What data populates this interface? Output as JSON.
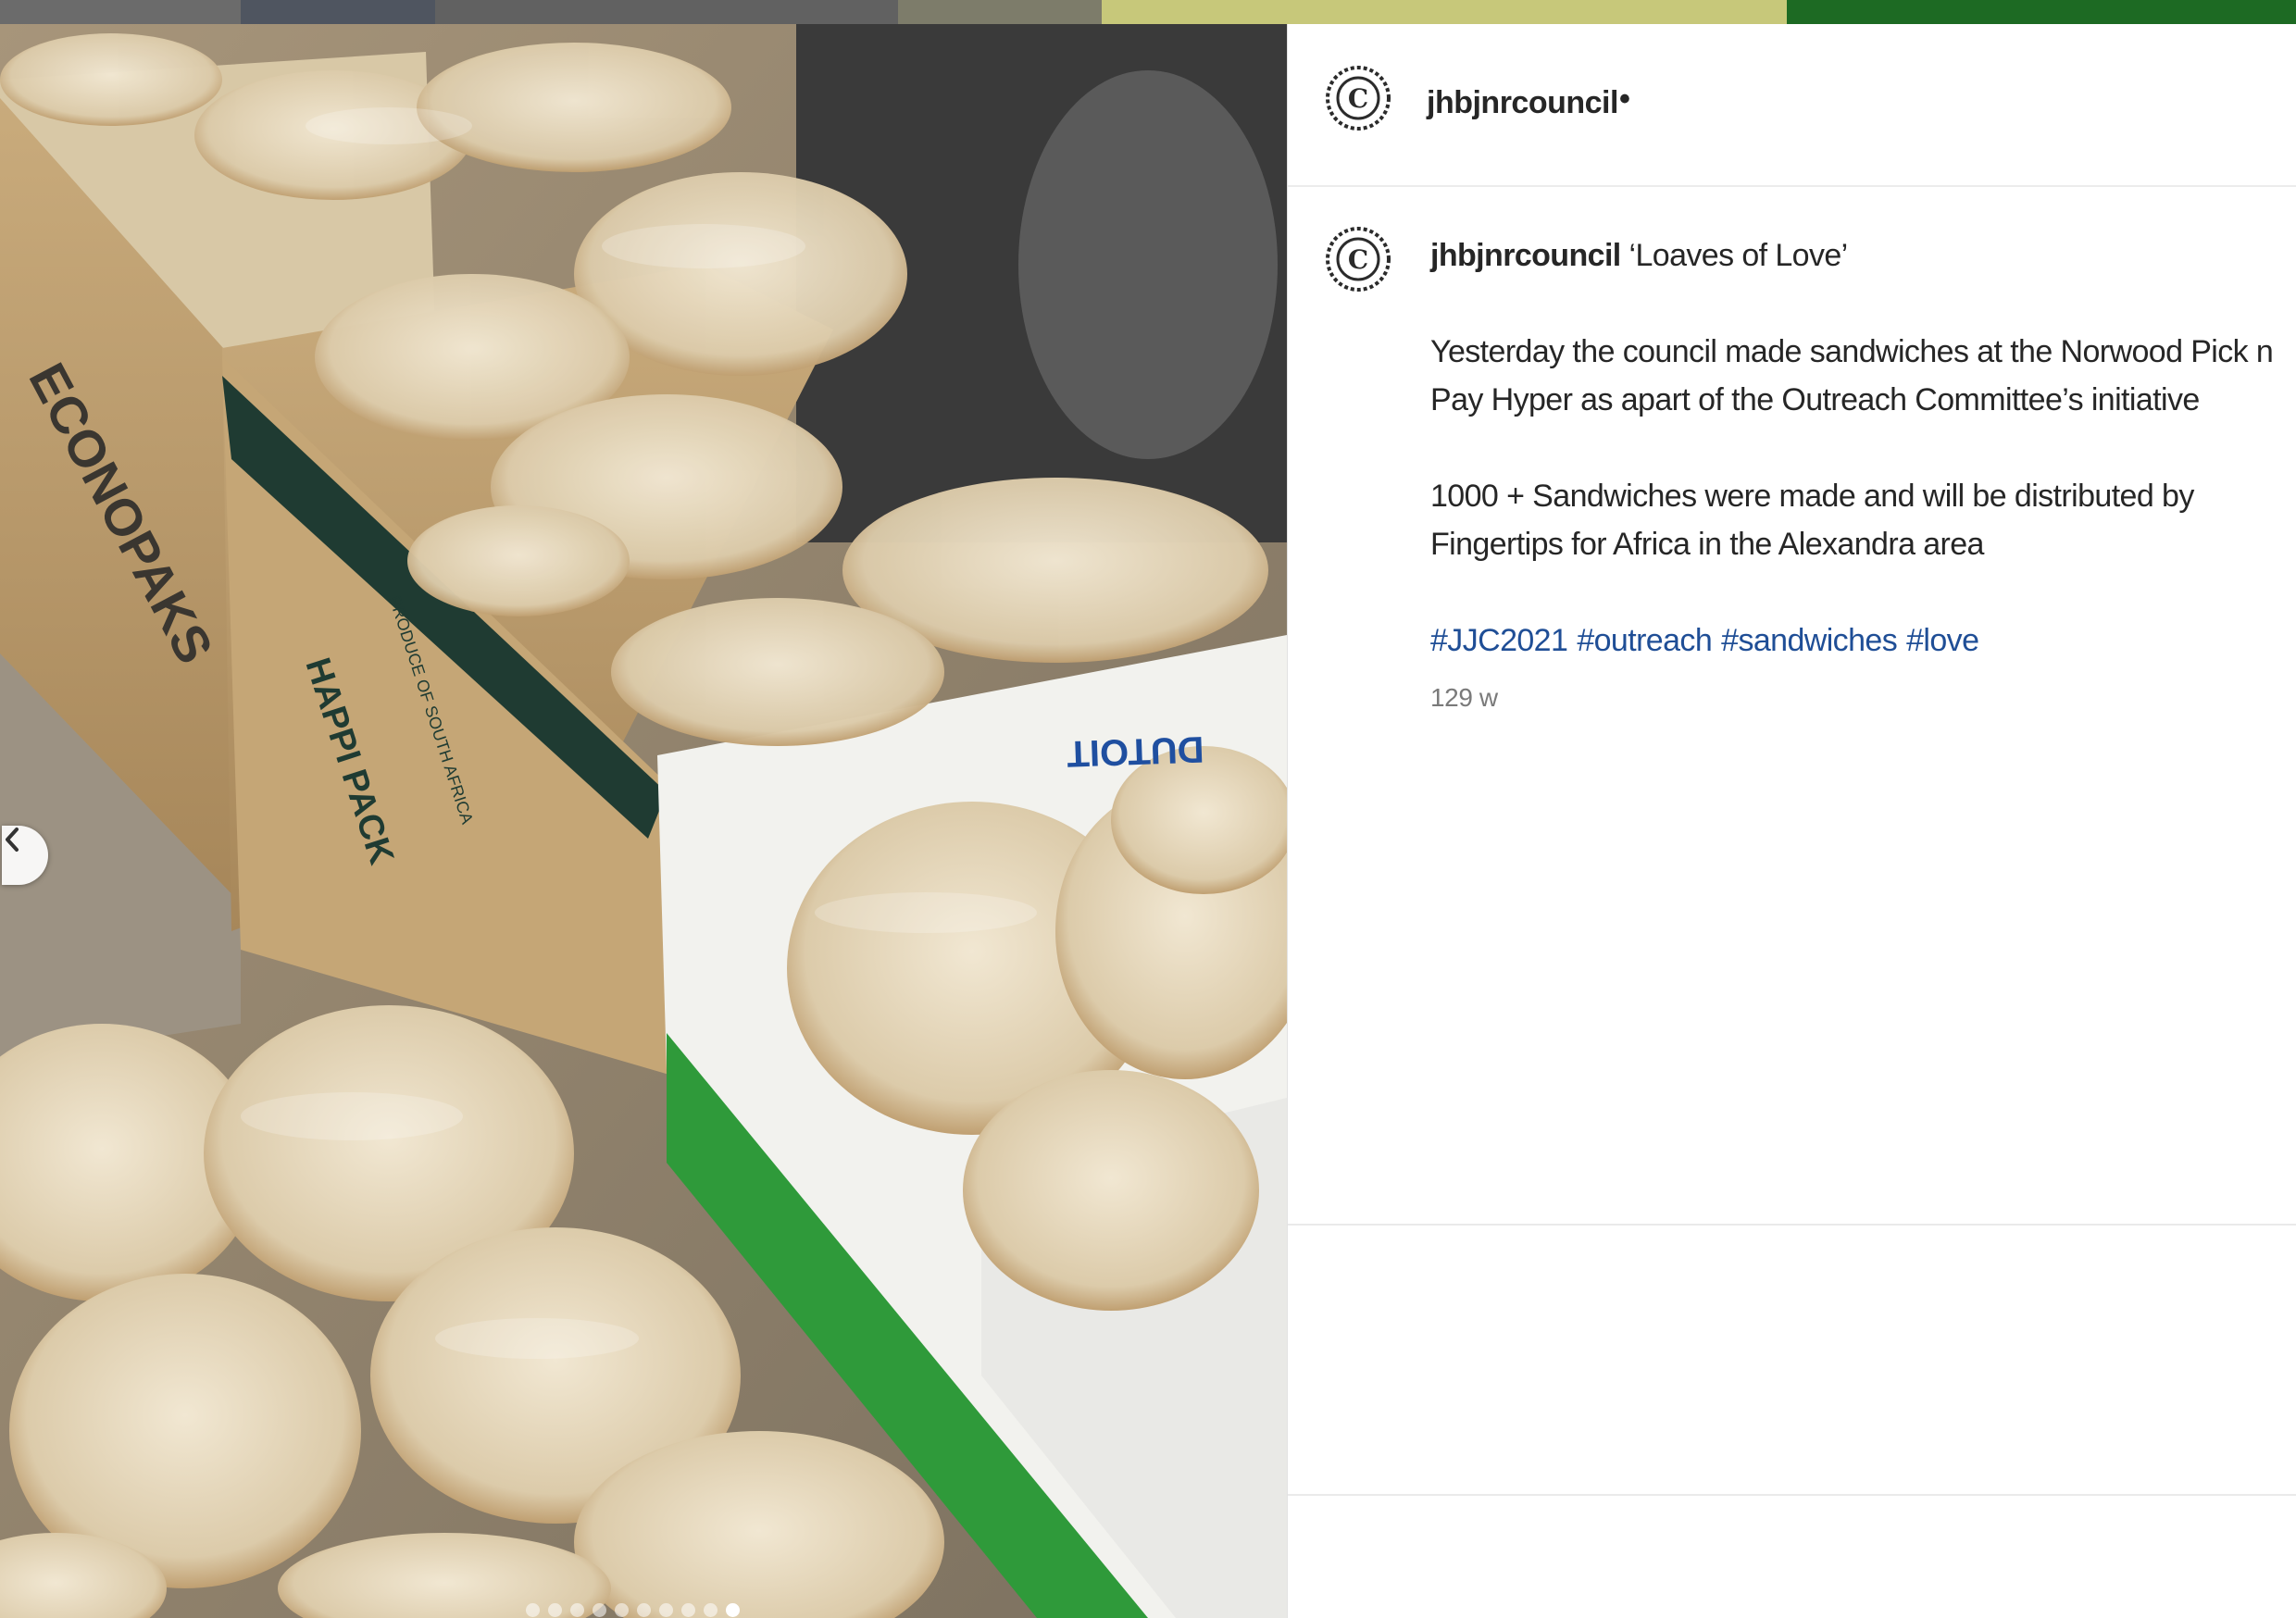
{
  "post": {
    "username": "jhbjnrcouncil",
    "follow_separator": "•",
    "caption": {
      "username": "jhbjnrcouncil",
      "title": "‘Loaves of Love’",
      "paragraph1": "Yesterday the council made sandwiches at the Norwood Pick n Pay Hyper as apart of the Outreach Committee’s initiative",
      "paragraph2": "1000 + Sandwiches were made and will be distributed by Fingertips for Africa in the Alexandra area",
      "hashtags": [
        "#JJC2021",
        "#outreach",
        "#sandwiches",
        "#love"
      ]
    },
    "timestamp": "129 w"
  },
  "carousel": {
    "total_slides": 10,
    "active_slide": 10
  },
  "photo_text": {
    "box1_brand": "ECONOPAKS",
    "box2_brand": "HAPPI PACK",
    "box2_sub": "PRODUCE OF SOUTH AFRICA",
    "box3_brand": "DUTOIT"
  },
  "colors": {
    "hashtag": "#1f4e96",
    "text": "#262626",
    "muted": "#7a7a7a"
  },
  "icons": {
    "prev": "chevron-left-icon",
    "avatar": "council-crest-icon"
  }
}
